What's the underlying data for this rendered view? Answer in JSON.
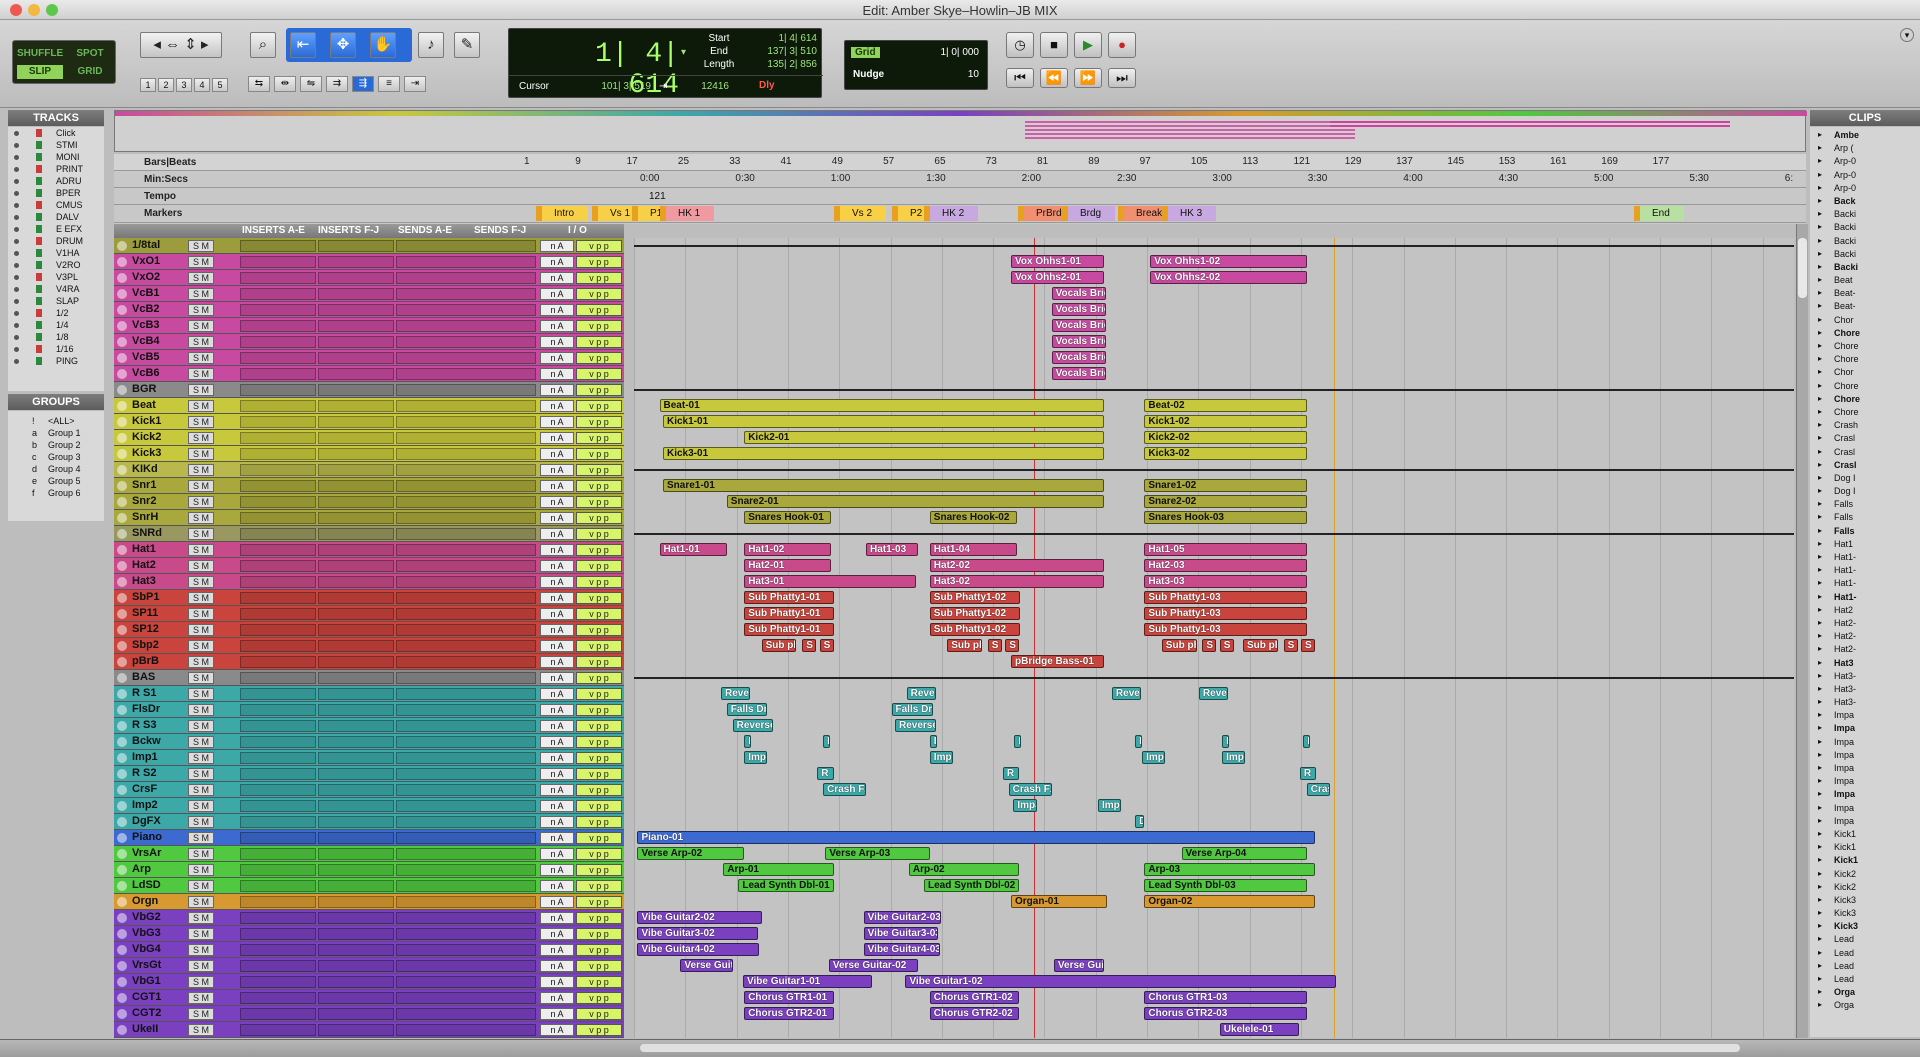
{
  "window": {
    "title": "Edit: Amber Skye–Howlin–JB MIX"
  },
  "modes": {
    "shuffle": "SHUFFLE",
    "spot": "SPOT",
    "slip": "SLIP",
    "grid": "GRID"
  },
  "zoom_presets": [
    "1",
    "2",
    "3",
    "4",
    "5"
  ],
  "counter": {
    "main": "1| 4| 614",
    "start_label": "Start",
    "start": "1| 4| 614",
    "end_label": "End",
    "end": "137| 3| 510",
    "length_label": "Length",
    "length": "135| 2| 856",
    "cursor_label": "Cursor",
    "cursor": "101| 3| 519",
    "sample": "12416",
    "dly": "Dly"
  },
  "grid": {
    "label": "Grid",
    "value": "1| 0| 000",
    "nudge_label": "Nudge",
    "nudge_value": "10"
  },
  "tracks_pane": {
    "title": "TRACKS",
    "items": [
      "Click",
      "STMI",
      "MONI",
      "PRINT",
      "ADRU",
      "BPER",
      "CMUS",
      "DALV",
      "E EFX",
      "DRUM",
      "V1HA",
      "V2RO",
      "V3PL",
      "V4RA",
      "SLAP",
      "1/2",
      "1/4",
      "1/8",
      "1/16",
      "PING"
    ]
  },
  "groups_pane": {
    "title": "GROUPS",
    "items": [
      {
        "id": "!",
        "name": "<ALL>"
      },
      {
        "id": "a",
        "name": "Group 1"
      },
      {
        "id": "b",
        "name": "Group 2"
      },
      {
        "id": "c",
        "name": "Group 3"
      },
      {
        "id": "d",
        "name": "Group 4"
      },
      {
        "id": "e",
        "name": "Group 5"
      },
      {
        "id": "f",
        "name": "Group 6"
      }
    ]
  },
  "clips_pane": {
    "title": "CLIPS",
    "items": [
      "Ambe",
      "Arp (",
      "Arp-0",
      "Arp-0",
      "Arp-0",
      "Back",
      "Backi",
      "Backi",
      "Backi",
      "Backi",
      "Backi",
      "Beat",
      "Beat-",
      "Beat-",
      "Chor",
      "Chore",
      "Chore",
      "Chore",
      "Chor",
      "Chore",
      "Chore",
      "Chore",
      "Crash",
      "Crasl",
      "Crasl",
      "Crasl",
      "Dog I",
      "Dog I",
      "Falls",
      "Falls",
      "Falls",
      "Hat1",
      "Hat1-",
      "Hat1-",
      "Hat1-",
      "Hat1-",
      "Hat2",
      "Hat2-",
      "Hat2-",
      "Hat2-",
      "Hat3",
      "Hat3-",
      "Hat3-",
      "Hat3-",
      "Impa",
      "Impa",
      "Impa",
      "Impa",
      "Impa",
      "Impa",
      "Impa",
      "Impa",
      "Impa",
      "Kick1",
      "Kick1",
      "Kick1",
      "Kick2",
      "Kick2",
      "Kick3",
      "Kick3",
      "Kick3",
      "Lead",
      "Lead",
      "Lead",
      "Lead",
      "Orga",
      "Orga"
    ]
  },
  "rulers": {
    "bars_label": "Bars|Beats",
    "min_label": "Min:Secs",
    "tempo_label": "Tempo",
    "markers_label": "Markers",
    "bars": [
      "1",
      "9",
      "17",
      "25",
      "33",
      "41",
      "49",
      "57",
      "65",
      "73",
      "81",
      "89",
      "97",
      "105",
      "113",
      "121",
      "129",
      "137",
      "145",
      "153",
      "161",
      "169",
      "177"
    ],
    "mins": [
      "0:00",
      "0:30",
      "1:00",
      "1:30",
      "2:00",
      "2:30",
      "3:00",
      "3:30",
      "4:00",
      "4:30",
      "5:00",
      "5:30",
      "6:"
    ],
    "tempo": "121",
    "markers": [
      "Intro",
      "Vs 1",
      "P1",
      "HK 1",
      "Vs 2",
      "P2",
      "HK 2",
      "PrBrdg",
      "Brdg",
      "Break",
      "HK 3",
      "End"
    ]
  },
  "track_header": {
    "inserts_ae": "INSERTS A-E",
    "inserts_fj": "INSERTS F-J",
    "sends_ae": "SENDS A-E",
    "sends_fj": "SENDS F-J",
    "io": "I / O"
  },
  "colors": {
    "vox": "#c84aa0",
    "drum": "#c8c83c",
    "snr": "#a8a83c",
    "hat": "#c84a8a",
    "sub": "#c8443c",
    "fx": "#3ca8a8",
    "keys": "#3c6ad0",
    "synth": "#50c840",
    "organ": "#d89a30",
    "gtr": "#7a40c0"
  },
  "tracks": [
    {
      "name": "1/8tal",
      "c": "#9c9c3c"
    },
    {
      "name": "VxO1",
      "c": "#c84aa0"
    },
    {
      "name": "VxO2",
      "c": "#c84aa0"
    },
    {
      "name": "VcB1",
      "c": "#c84aa0"
    },
    {
      "name": "VcB2",
      "c": "#c84aa0"
    },
    {
      "name": "VcB3",
      "c": "#c84aa0"
    },
    {
      "name": "VcB4",
      "c": "#c84aa0"
    },
    {
      "name": "VcB5",
      "c": "#c84aa0"
    },
    {
      "name": "VcB6",
      "c": "#c84aa0"
    },
    {
      "name": "BGR",
      "c": "#8a8a8a"
    },
    {
      "name": "Beat",
      "c": "#c8c83c"
    },
    {
      "name": "Kick1",
      "c": "#c8c83c"
    },
    {
      "name": "Kick2",
      "c": "#c8c83c"
    },
    {
      "name": "Kick3",
      "c": "#c8c83c"
    },
    {
      "name": "KIKd",
      "c": "#b8b84c"
    },
    {
      "name": "Snr1",
      "c": "#a8a83c"
    },
    {
      "name": "Snr2",
      "c": "#a8a83c"
    },
    {
      "name": "SnrH",
      "c": "#a8a83c"
    },
    {
      "name": "SNRd",
      "c": "#989860"
    },
    {
      "name": "Hat1",
      "c": "#c84a8a"
    },
    {
      "name": "Hat2",
      "c": "#c84a8a"
    },
    {
      "name": "Hat3",
      "c": "#c84a8a"
    },
    {
      "name": "SbP1",
      "c": "#c8443c"
    },
    {
      "name": "SP11",
      "c": "#c8443c"
    },
    {
      "name": "SP12",
      "c": "#c8443c"
    },
    {
      "name": "Sbp2",
      "c": "#c8443c"
    },
    {
      "name": "pBrB",
      "c": "#c8443c"
    },
    {
      "name": "BAS",
      "c": "#8a8a8a"
    },
    {
      "name": "R S1",
      "c": "#3ca8a8"
    },
    {
      "name": "FlsDr",
      "c": "#3ca8a8"
    },
    {
      "name": "R S3",
      "c": "#3ca8a8"
    },
    {
      "name": "Bckw",
      "c": "#3ca8a8"
    },
    {
      "name": "Imp1",
      "c": "#3ca8a8"
    },
    {
      "name": "R S2",
      "c": "#3ca8a8"
    },
    {
      "name": "CrsF",
      "c": "#3ca8a8"
    },
    {
      "name": "Imp2",
      "c": "#3ca8a8"
    },
    {
      "name": "DgFX",
      "c": "#3ca8a8"
    },
    {
      "name": "Piano",
      "c": "#3c6ad0"
    },
    {
      "name": "VrsAr",
      "c": "#50c840"
    },
    {
      "name": "Arp",
      "c": "#50c840"
    },
    {
      "name": "LdSD",
      "c": "#50c840"
    },
    {
      "name": "Orgn",
      "c": "#d89a30"
    },
    {
      "name": "VbG2",
      "c": "#7a40c0"
    },
    {
      "name": "VbG3",
      "c": "#7a40c0"
    },
    {
      "name": "VbG4",
      "c": "#7a40c0"
    },
    {
      "name": "VrsGt",
      "c": "#7a40c0"
    },
    {
      "name": "VbG1",
      "c": "#7a40c0"
    },
    {
      "name": "CGT1",
      "c": "#7a40c0"
    },
    {
      "name": "CGT2",
      "c": "#7a40c0"
    },
    {
      "name": "UkeII",
      "c": "#7a40c0"
    }
  ],
  "clips": [
    {
      "t": 1,
      "label": "Vox Ohhs1-01",
      "s": 0.325,
      "e": 0.405,
      "c": "#c84aa0"
    },
    {
      "t": 1,
      "label": "Vox Ohhs1-02",
      "s": 0.445,
      "e": 0.58,
      "c": "#c84aa0"
    },
    {
      "t": 2,
      "label": "Vox Ohhs2-01",
      "s": 0.325,
      "e": 0.405,
      "c": "#c84aa0"
    },
    {
      "t": 2,
      "label": "Vox Ohhs2-02",
      "s": 0.445,
      "e": 0.58,
      "c": "#c84aa0"
    },
    {
      "t": 3,
      "label": "Vocals Brid",
      "s": 0.36,
      "e": 0.407,
      "c": "#c84aa0"
    },
    {
      "t": 4,
      "label": "Vocals Brid",
      "s": 0.36,
      "e": 0.407,
      "c": "#c84aa0"
    },
    {
      "t": 5,
      "label": "Vocals Brid",
      "s": 0.36,
      "e": 0.407,
      "c": "#c84aa0"
    },
    {
      "t": 6,
      "label": "Vocals Brid",
      "s": 0.36,
      "e": 0.407,
      "c": "#c84aa0"
    },
    {
      "t": 7,
      "label": "Vocals Brid",
      "s": 0.36,
      "e": 0.407,
      "c": "#c84aa0"
    },
    {
      "t": 8,
      "label": "Vocals Brid",
      "s": 0.36,
      "e": 0.407,
      "c": "#c84aa0"
    },
    {
      "t": 10,
      "label": "Beat-01",
      "s": 0.022,
      "e": 0.405,
      "c": "#c8c83c"
    },
    {
      "t": 10,
      "label": "Beat-02",
      "s": 0.44,
      "e": 0.58,
      "c": "#c8c83c"
    },
    {
      "t": 11,
      "label": "Kick1-01",
      "s": 0.025,
      "e": 0.405,
      "c": "#c8c83c"
    },
    {
      "t": 11,
      "label": "Kick1-02",
      "s": 0.44,
      "e": 0.58,
      "c": "#c8c83c"
    },
    {
      "t": 12,
      "label": "Kick2-01",
      "s": 0.095,
      "e": 0.405,
      "c": "#c8c83c"
    },
    {
      "t": 12,
      "label": "Kick2-02",
      "s": 0.44,
      "e": 0.58,
      "c": "#c8c83c"
    },
    {
      "t": 13,
      "label": "Kick3-01",
      "s": 0.025,
      "e": 0.405,
      "c": "#c8c83c"
    },
    {
      "t": 13,
      "label": "Kick3-02",
      "s": 0.44,
      "e": 0.58,
      "c": "#c8c83c"
    },
    {
      "t": 15,
      "label": "Snare1-01",
      "s": 0.025,
      "e": 0.405,
      "c": "#a8a83c"
    },
    {
      "t": 15,
      "label": "Snare1-02",
      "s": 0.44,
      "e": 0.58,
      "c": "#a8a83c"
    },
    {
      "t": 16,
      "label": "Snare2-01",
      "s": 0.08,
      "e": 0.405,
      "c": "#a8a83c"
    },
    {
      "t": 16,
      "label": "Snare2-02",
      "s": 0.44,
      "e": 0.58,
      "c": "#a8a83c"
    },
    {
      "t": 17,
      "label": "Snares Hook-01",
      "s": 0.095,
      "e": 0.17,
      "c": "#a8a83c"
    },
    {
      "t": 17,
      "label": "Snares Hook-02",
      "s": 0.255,
      "e": 0.33,
      "c": "#a8a83c"
    },
    {
      "t": 17,
      "label": "Snares Hook-03",
      "s": 0.44,
      "e": 0.58,
      "c": "#a8a83c"
    },
    {
      "t": 19,
      "label": "Hat1-01",
      "s": 0.022,
      "e": 0.08,
      "c": "#c84a8a"
    },
    {
      "t": 19,
      "label": "Hat1-02",
      "s": 0.095,
      "e": 0.17,
      "c": "#c84a8a"
    },
    {
      "t": 19,
      "label": "Hat1-03",
      "s": 0.2,
      "e": 0.245,
      "c": "#c84a8a"
    },
    {
      "t": 19,
      "label": "Hat1-04",
      "s": 0.255,
      "e": 0.33,
      "c": "#c84a8a"
    },
    {
      "t": 19,
      "label": "Hat1-05",
      "s": 0.44,
      "e": 0.58,
      "c": "#c84a8a"
    },
    {
      "t": 20,
      "label": "Hat2-01",
      "s": 0.095,
      "e": 0.17,
      "c": "#c84a8a"
    },
    {
      "t": 20,
      "label": "Hat2-02",
      "s": 0.255,
      "e": 0.405,
      "c": "#c84a8a"
    },
    {
      "t": 20,
      "label": "Hat2-03",
      "s": 0.44,
      "e": 0.58,
      "c": "#c84a8a"
    },
    {
      "t": 21,
      "label": "Hat3-01",
      "s": 0.095,
      "e": 0.243,
      "c": "#c84a8a"
    },
    {
      "t": 21,
      "label": "Hat3-02",
      "s": 0.255,
      "e": 0.405,
      "c": "#c84a8a"
    },
    {
      "t": 21,
      "label": "Hat3-03",
      "s": 0.44,
      "e": 0.58,
      "c": "#c84a8a"
    },
    {
      "t": 22,
      "label": "Sub Phatty1-01",
      "s": 0.095,
      "e": 0.172,
      "c": "#c8443c"
    },
    {
      "t": 22,
      "label": "Sub Phatty1-02",
      "s": 0.255,
      "e": 0.333,
      "c": "#c8443c"
    },
    {
      "t": 22,
      "label": "Sub Phatty1-03",
      "s": 0.44,
      "e": 0.58,
      "c": "#c8443c"
    },
    {
      "t": 23,
      "label": "Sub Phatty1-01",
      "s": 0.095,
      "e": 0.172,
      "c": "#c8443c"
    },
    {
      "t": 23,
      "label": "Sub Phatty1-02",
      "s": 0.255,
      "e": 0.333,
      "c": "#c8443c"
    },
    {
      "t": 23,
      "label": "Sub Phatty1-03",
      "s": 0.44,
      "e": 0.58,
      "c": "#c8443c"
    },
    {
      "t": 24,
      "label": "Sub Phatty1-01",
      "s": 0.095,
      "e": 0.172,
      "c": "#c8443c"
    },
    {
      "t": 24,
      "label": "Sub Phatty1-02",
      "s": 0.255,
      "e": 0.333,
      "c": "#c8443c"
    },
    {
      "t": 24,
      "label": "Sub Phatty1-03",
      "s": 0.44,
      "e": 0.58,
      "c": "#c8443c"
    },
    {
      "t": 25,
      "label": "Sub ph",
      "s": 0.11,
      "e": 0.14,
      "c": "#c8443c"
    },
    {
      "t": 25,
      "label": "S",
      "s": 0.145,
      "e": 0.157,
      "c": "#c8443c"
    },
    {
      "t": 25,
      "label": "S",
      "s": 0.16,
      "e": 0.172,
      "c": "#c8443c"
    },
    {
      "t": 25,
      "label": "Sub ph",
      "s": 0.27,
      "e": 0.3,
      "c": "#c8443c"
    },
    {
      "t": 25,
      "label": "S",
      "s": 0.305,
      "e": 0.317,
      "c": "#c8443c"
    },
    {
      "t": 25,
      "label": "S",
      "s": 0.32,
      "e": 0.332,
      "c": "#c8443c"
    },
    {
      "t": 25,
      "label": "Sub ph",
      "s": 0.455,
      "e": 0.485,
      "c": "#c8443c"
    },
    {
      "t": 25,
      "label": "S",
      "s": 0.49,
      "e": 0.502,
      "c": "#c8443c"
    },
    {
      "t": 25,
      "label": "S",
      "s": 0.505,
      "e": 0.517,
      "c": "#c8443c"
    },
    {
      "t": 25,
      "label": "Sub ph",
      "s": 0.525,
      "e": 0.555,
      "c": "#c8443c"
    },
    {
      "t": 25,
      "label": "S",
      "s": 0.56,
      "e": 0.572,
      "c": "#c8443c"
    },
    {
      "t": 25,
      "label": "S",
      "s": 0.575,
      "e": 0.587,
      "c": "#c8443c"
    },
    {
      "t": 26,
      "label": "pBridge Bass-01",
      "s": 0.325,
      "e": 0.405,
      "c": "#c8443c"
    },
    {
      "t": 28,
      "label": "Rever",
      "s": 0.075,
      "e": 0.1,
      "c": "#3ca8a8"
    },
    {
      "t": 28,
      "label": "Rever",
      "s": 0.235,
      "e": 0.26,
      "c": "#3ca8a8"
    },
    {
      "t": 28,
      "label": "Rever",
      "s": 0.412,
      "e": 0.437,
      "c": "#3ca8a8"
    },
    {
      "t": 28,
      "label": "Rever",
      "s": 0.487,
      "e": 0.512,
      "c": "#3ca8a8"
    },
    {
      "t": 29,
      "label": "Falls Dro",
      "s": 0.08,
      "e": 0.115,
      "c": "#3ca8a8"
    },
    {
      "t": 29,
      "label": "Falls Dro",
      "s": 0.222,
      "e": 0.258,
      "c": "#3ca8a8"
    },
    {
      "t": 30,
      "label": "Reverse_",
      "s": 0.085,
      "e": 0.12,
      "c": "#3ca8a8"
    },
    {
      "t": 30,
      "label": "Reverse_",
      "s": 0.225,
      "e": 0.26,
      "c": "#3ca8a8"
    },
    {
      "t": 31,
      "label": "B",
      "s": 0.095,
      "e": 0.101,
      "c": "#3ca8a8"
    },
    {
      "t": 31,
      "label": "B",
      "s": 0.163,
      "e": 0.169,
      "c": "#3ca8a8"
    },
    {
      "t": 31,
      "label": "B",
      "s": 0.255,
      "e": 0.261,
      "c": "#3ca8a8"
    },
    {
      "t": 31,
      "label": "B",
      "s": 0.328,
      "e": 0.334,
      "c": "#3ca8a8"
    },
    {
      "t": 31,
      "label": "B",
      "s": 0.432,
      "e": 0.438,
      "c": "#3ca8a8"
    },
    {
      "t": 31,
      "label": "B",
      "s": 0.507,
      "e": 0.513,
      "c": "#3ca8a8"
    },
    {
      "t": 31,
      "label": "B",
      "s": 0.577,
      "e": 0.583,
      "c": "#3ca8a8"
    },
    {
      "t": 32,
      "label": "Impa",
      "s": 0.095,
      "e": 0.115,
      "c": "#3ca8a8"
    },
    {
      "t": 32,
      "label": "Impa",
      "s": 0.255,
      "e": 0.275,
      "c": "#3ca8a8"
    },
    {
      "t": 32,
      "label": "Impa",
      "s": 0.438,
      "e": 0.458,
      "c": "#3ca8a8"
    },
    {
      "t": 32,
      "label": "Impa",
      "s": 0.507,
      "e": 0.527,
      "c": "#3ca8a8"
    },
    {
      "t": 33,
      "label": "R",
      "s": 0.158,
      "e": 0.172,
      "c": "#3ca8a8"
    },
    {
      "t": 33,
      "label": "R",
      "s": 0.318,
      "e": 0.332,
      "c": "#3ca8a8"
    },
    {
      "t": 33,
      "label": "R",
      "s": 0.574,
      "e": 0.588,
      "c": "#3ca8a8"
    },
    {
      "t": 34,
      "label": "Crash Fx",
      "s": 0.163,
      "e": 0.2,
      "c": "#3ca8a8"
    },
    {
      "t": 34,
      "label": "Crash Fx",
      "s": 0.323,
      "e": 0.36,
      "c": "#3ca8a8"
    },
    {
      "t": 34,
      "label": "Crash",
      "s": 0.58,
      "e": 0.6,
      "c": "#3ca8a8"
    },
    {
      "t": 35,
      "label": "Impa",
      "s": 0.327,
      "e": 0.347,
      "c": "#3ca8a8"
    },
    {
      "t": 35,
      "label": "Impa",
      "s": 0.4,
      "e": 0.42,
      "c": "#3ca8a8"
    },
    {
      "t": 36,
      "label": "D",
      "s": 0.432,
      "e": 0.44,
      "c": "#3ca8a8"
    },
    {
      "t": 37,
      "label": "Piano-01",
      "s": 0.003,
      "e": 0.587,
      "c": "#3c6ad0"
    },
    {
      "t": 38,
      "label": "Verse Arp-02",
      "s": 0.003,
      "e": 0.095,
      "c": "#50c840"
    },
    {
      "t": 38,
      "label": "Verse Arp-03",
      "s": 0.165,
      "e": 0.255,
      "c": "#50c840"
    },
    {
      "t": 38,
      "label": "Verse Arp-04",
      "s": 0.472,
      "e": 0.58,
      "c": "#50c840"
    },
    {
      "t": 39,
      "label": "Arp-01",
      "s": 0.077,
      "e": 0.172,
      "c": "#50c840"
    },
    {
      "t": 39,
      "label": "Arp-02",
      "s": 0.237,
      "e": 0.332,
      "c": "#50c840"
    },
    {
      "t": 39,
      "label": "Arp-03",
      "s": 0.44,
      "e": 0.587,
      "c": "#50c840"
    },
    {
      "t": 40,
      "label": "Lead Synth Dbl-01",
      "s": 0.09,
      "e": 0.172,
      "c": "#50c840"
    },
    {
      "t": 40,
      "label": "Lead Synth Dbl-02",
      "s": 0.25,
      "e": 0.332,
      "c": "#50c840"
    },
    {
      "t": 40,
      "label": "Lead Synth Dbl-03",
      "s": 0.44,
      "e": 0.58,
      "c": "#50c840"
    },
    {
      "t": 41,
      "label": "Organ-01",
      "s": 0.325,
      "e": 0.408,
      "c": "#d89a30"
    },
    {
      "t": 41,
      "label": "Organ-02",
      "s": 0.44,
      "e": 0.587,
      "c": "#d89a30"
    },
    {
      "t": 42,
      "label": "Vibe Guitar2-02",
      "s": 0.003,
      "e": 0.11,
      "c": "#7a40c0"
    },
    {
      "t": 42,
      "label": "Vibe Guitar2-03",
      "s": 0.198,
      "e": 0.265,
      "c": "#7a40c0"
    },
    {
      "t": 43,
      "label": "Vibe Guitar3-02",
      "s": 0.003,
      "e": 0.107,
      "c": "#7a40c0"
    },
    {
      "t": 43,
      "label": "Vibe Guitar3-03",
      "s": 0.198,
      "e": 0.262,
      "c": "#7a40c0"
    },
    {
      "t": 44,
      "label": "Vibe Guitar4-02",
      "s": 0.003,
      "e": 0.108,
      "c": "#7a40c0"
    },
    {
      "t": 44,
      "label": "Vibe Guitar4-03",
      "s": 0.198,
      "e": 0.264,
      "c": "#7a40c0"
    },
    {
      "t": 45,
      "label": "Verse Guita",
      "s": 0.04,
      "e": 0.085,
      "c": "#7a40c0"
    },
    {
      "t": 45,
      "label": "Verse Guitar-02",
      "s": 0.168,
      "e": 0.245,
      "c": "#7a40c0"
    },
    {
      "t": 45,
      "label": "Verse Guit",
      "s": 0.362,
      "e": 0.405,
      "c": "#7a40c0"
    },
    {
      "t": 46,
      "label": "Vibe Guitar1-01",
      "s": 0.094,
      "e": 0.205,
      "c": "#7a40c0"
    },
    {
      "t": 46,
      "label": "Vibe Guitar1-02",
      "s": 0.234,
      "e": 0.605,
      "c": "#7a40c0"
    },
    {
      "t": 47,
      "label": "Chorus GTR1-01",
      "s": 0.095,
      "e": 0.172,
      "c": "#7a40c0"
    },
    {
      "t": 47,
      "label": "Chorus GTR1-02",
      "s": 0.255,
      "e": 0.332,
      "c": "#7a40c0"
    },
    {
      "t": 47,
      "label": "Chorus GTR1-03",
      "s": 0.44,
      "e": 0.58,
      "c": "#7a40c0"
    },
    {
      "t": 48,
      "label": "Chorus GTR2-01",
      "s": 0.095,
      "e": 0.172,
      "c": "#7a40c0"
    },
    {
      "t": 48,
      "label": "Chorus GTR2-02",
      "s": 0.255,
      "e": 0.332,
      "c": "#7a40c0"
    },
    {
      "t": 48,
      "label": "Chorus GTR2-03",
      "s": 0.44,
      "e": 0.58,
      "c": "#7a40c0"
    },
    {
      "t": 49,
      "label": "Ukelele-01",
      "s": 0.505,
      "e": 0.573,
      "c": "#7a40c0"
    }
  ]
}
